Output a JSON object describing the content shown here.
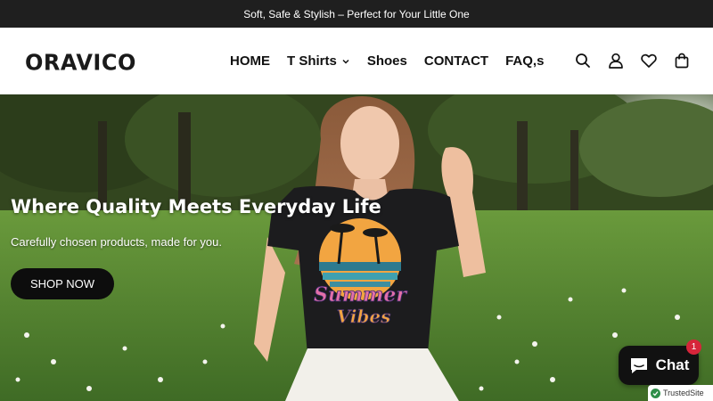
{
  "announcement": {
    "text": "Soft, Safe & Stylish – Perfect for Your Little One"
  },
  "header": {
    "logo": "ORAVICO",
    "nav": [
      {
        "label": "HOME"
      },
      {
        "label": "T Shirts",
        "has_dropdown": true
      },
      {
        "label": "Shoes"
      },
      {
        "label": "CONTACT"
      },
      {
        "label": "FAQ,s"
      }
    ],
    "icons": [
      "search-icon",
      "account-icon",
      "wishlist-heart-icon",
      "cart-bag-icon"
    ]
  },
  "hero": {
    "title": "Where Quality Meets Everyday Life",
    "subtitle": "Carefully chosen products, made for you.",
    "button_label": "SHOP NOW",
    "shirt_text_top": "Summer",
    "shirt_text_bottom": "Vibes"
  },
  "chat_widget": {
    "label": "Chat",
    "badge_count": "1"
  },
  "trust_badge": {
    "label": "TrustedSite"
  },
  "colors": {
    "announcement_bg": "#1f1f1f",
    "button_bg": "#0d0d0d",
    "badge_red": "#d6253a",
    "trusted_green": "#2f8f4a"
  }
}
